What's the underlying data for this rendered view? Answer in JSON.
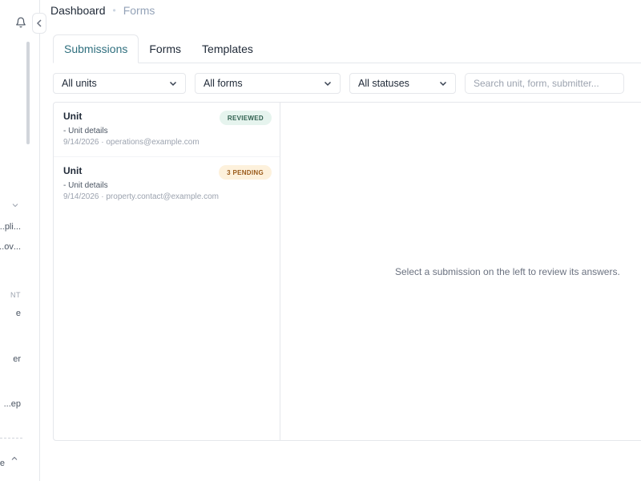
{
  "sidebar": {
    "items": [
      {
        "label": "...pli..."
      },
      {
        "label": "...ov..."
      },
      {
        "label": "NT"
      },
      {
        "label": "e"
      },
      {
        "label": "er"
      },
      {
        "label": "ep..."
      },
      {
        "label": "e"
      }
    ]
  },
  "breadcrumb": {
    "main": "Dashboard",
    "separator": "•",
    "current": "Forms"
  },
  "tabs": [
    {
      "label": "Submissions",
      "active": true
    },
    {
      "label": "Forms",
      "active": false
    },
    {
      "label": "Templates",
      "active": false
    }
  ],
  "filters": {
    "units": "All units",
    "forms": "All forms",
    "statuses": "All statuses",
    "search_placeholder": "Search unit, form, submitter..."
  },
  "submissions": [
    {
      "title": "Unit",
      "details": "- Unit details",
      "meta": "9/14/2026 · operations@example.com",
      "badge": "REVIEWED",
      "badge_color": "#2f5f4e"
    },
    {
      "title": "Unit",
      "details": "- Unit details",
      "meta": "9/14/2026 · property.contact@example.com",
      "badge": "3 PENDING",
      "badge_color": "#9a5a1a"
    }
  ],
  "detail": {
    "empty_message": "Select a submission on the left to review its answers."
  },
  "colors": {
    "accent": "#2f6f7e",
    "border": "#e5e7eb"
  }
}
